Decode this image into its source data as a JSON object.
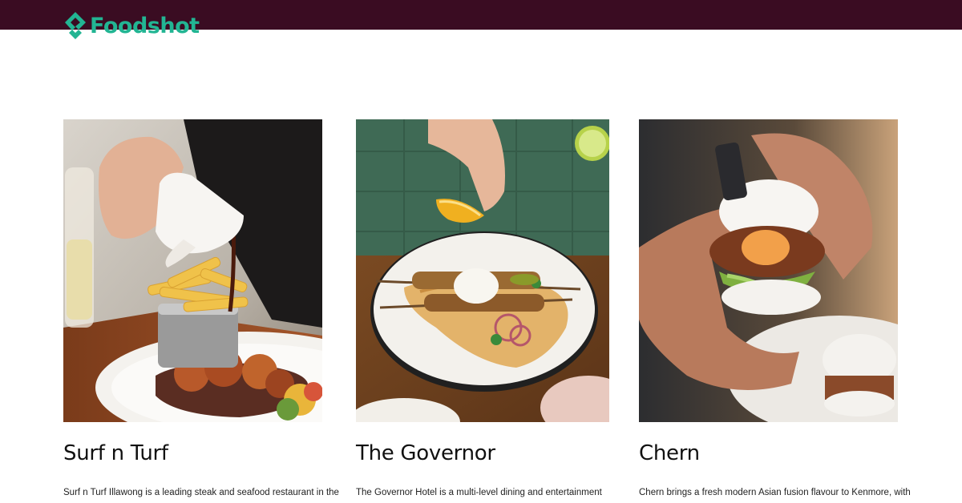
{
  "header": {
    "brand_name": "Foodshot",
    "brand_color": "#22b593",
    "bar_color": "#3a0c22"
  },
  "cards": [
    {
      "title": "Surf n Turf",
      "excerpt": "Surf n Turf Illawong is a leading steak and seafood restaurant in the",
      "image_description_icon": "steak-and-fries-photo"
    },
    {
      "title": "The Governor",
      "excerpt": "The Governor Hotel is a multi-level dining and entertainment",
      "image_description_icon": "souvlaki-flatbread-photo"
    },
    {
      "title": "Chern",
      "excerpt": "Chern brings a fresh modern Asian fusion flavour to Kenmore, with",
      "image_description_icon": "bao-bun-photo"
    }
  ]
}
